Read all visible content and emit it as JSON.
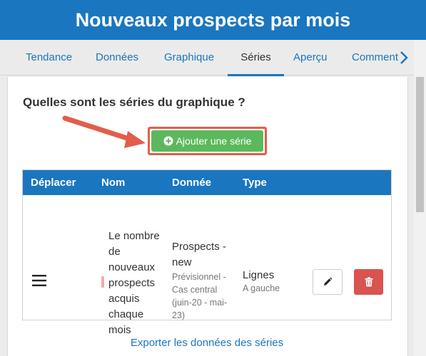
{
  "window": {
    "title": "Nouveaux prospects par mois"
  },
  "tabs": [
    {
      "label": "Tendance",
      "active": false
    },
    {
      "label": "Données",
      "active": false
    },
    {
      "label": "Graphique",
      "active": false
    },
    {
      "label": "Séries",
      "active": true
    },
    {
      "label": "Aperçu",
      "active": false
    },
    {
      "label": "Comment",
      "active": false
    }
  ],
  "icons": {
    "next_tabs": "chevron-right-icon",
    "add": "plus-circle-icon",
    "drag": "drag-handle-icon",
    "edit": "pencil-icon",
    "delete": "trash-icon"
  },
  "main": {
    "question": "Quelles sont les séries du graphique ?",
    "add_button": "Ajouter une série"
  },
  "table": {
    "columns": [
      "Déplacer",
      "Nom",
      "Donnée",
      "Type"
    ],
    "rows": [
      {
        "name": "Le nombre de nouveaux prospects acquis chaque mois",
        "data_name": "Prospects - new",
        "data_detail": "Prévisionnel - Cas central (juin-20 - mai-23)",
        "type": "Lignes",
        "axis": "A gauche",
        "series_color": "#f4a8a8"
      }
    ]
  },
  "footer": {
    "export_link": "Exporter les données des séries"
  },
  "colors": {
    "primary": "#1a76bf",
    "add_button": "#5cb85c",
    "delete_button": "#d9534f",
    "highlight": "#e35d4b"
  }
}
